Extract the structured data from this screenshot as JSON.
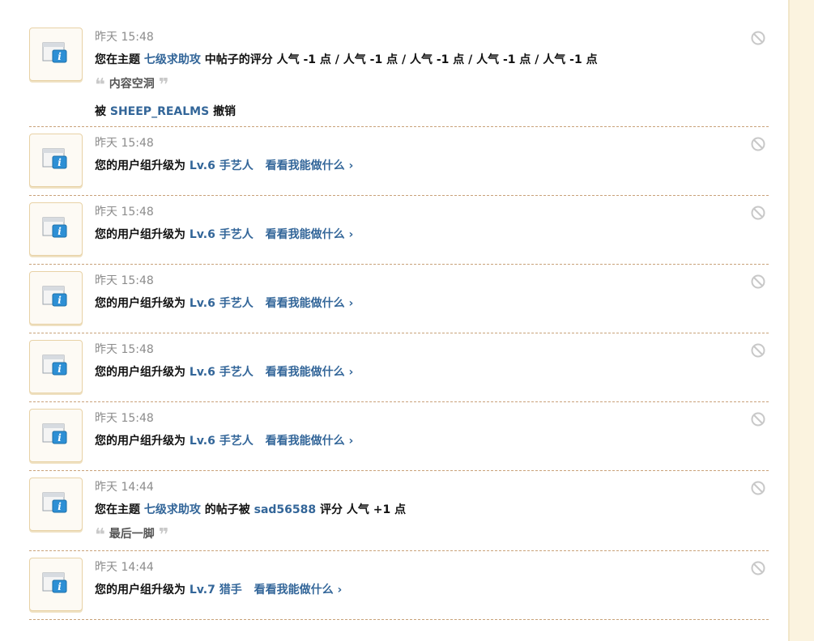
{
  "items": [
    {
      "time": "昨天 15:48",
      "prefix": "您在主题",
      "topic": "七级求助攻",
      "middle": "中帖子的评分 人气 -1 点 / 人气 -1 点 / 人气 -1 点 / 人气 -1 点 / 人气 -1 点",
      "quote": "内容空洞",
      "by_prefix": "被",
      "by_user": "SHEEP_REALMS",
      "by_suffix": "撤销"
    },
    {
      "time": "昨天 15:48",
      "prefix": "您的用户组升级为",
      "level": "Lv.6 手艺人",
      "link": "看看我能做什么 ›"
    },
    {
      "time": "昨天 15:48",
      "prefix": "您的用户组升级为",
      "level": "Lv.6 手艺人",
      "link": "看看我能做什么 ›"
    },
    {
      "time": "昨天 15:48",
      "prefix": "您的用户组升级为",
      "level": "Lv.6 手艺人",
      "link": "看看我能做什么 ›"
    },
    {
      "time": "昨天 15:48",
      "prefix": "您的用户组升级为",
      "level": "Lv.6 手艺人",
      "link": "看看我能做什么 ›"
    },
    {
      "time": "昨天 15:48",
      "prefix": "您的用户组升级为",
      "level": "Lv.6 手艺人",
      "link": "看看我能做什么 ›"
    },
    {
      "time": "昨天 14:44",
      "prefix": "您在主题",
      "topic": "七级求助攻",
      "middle": "的帖子被",
      "user": "sad56588",
      "suffix": "评分 人气 +1 点",
      "quote": "最后一脚"
    },
    {
      "time": "昨天 14:44",
      "prefix": "您的用户组升级为",
      "level": "Lv.7 猎手",
      "link": "看看我能做什么 ›"
    }
  ],
  "quote_open": "❝",
  "quote_close": "❞",
  "icons": {
    "avatar": "system-notice-icon",
    "ignore": "ignore-icon"
  },
  "colors": {
    "link": "#336699",
    "time": "#8c8c8c",
    "separator": "#c9a27a",
    "background": "#fbf3df"
  }
}
